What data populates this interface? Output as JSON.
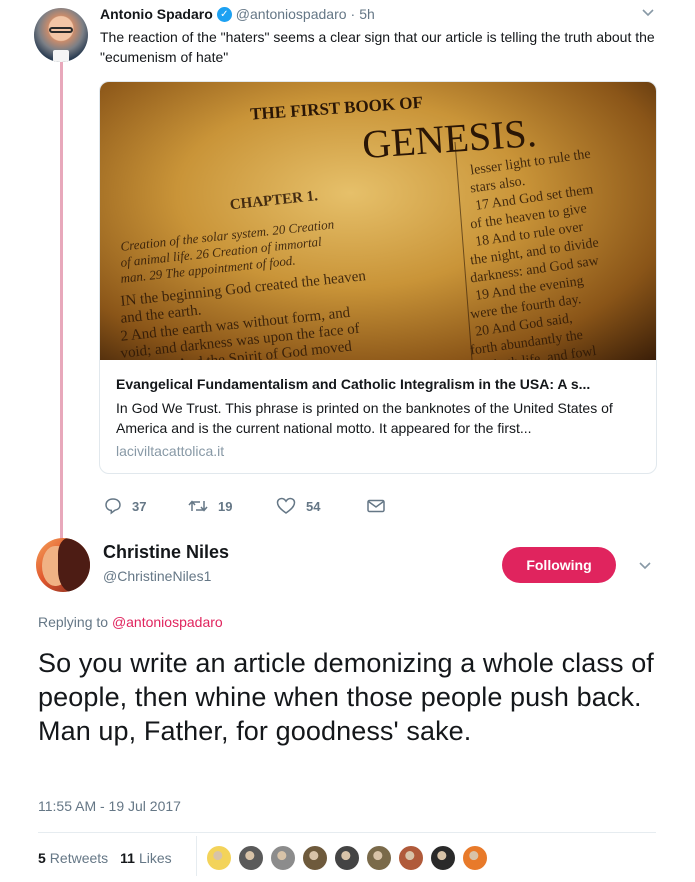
{
  "parent_tweet": {
    "name": "Antonio Spadaro",
    "handle": "@antoniospadaro",
    "time": "5h",
    "text": "The reaction of the \"haters\" seems a clear sign that our article is telling the truth about the \"ecumenism of hate\"",
    "card": {
      "image_title_line": "THE FIRST BOOK OF",
      "image_heading": "GENESIS.",
      "title": "Evangelical Fundamentalism and Catholic Integralism in the USA: A s...",
      "description": "In God We Trust. This phrase is printed on the banknotes of the United States of America and is the current national motto. It appeared for the first...",
      "domain": "laciviltacattolica.it"
    },
    "actions": {
      "replies": "37",
      "retweets": "19",
      "likes": "54"
    }
  },
  "main_tweet": {
    "name": "Christine Niles",
    "handle": "@ChristineNiles1",
    "follow_label": "Following",
    "replying_prefix": "Replying to",
    "replying_to": "@antoniospadaro",
    "text": "So you write an article demonizing a whole class of people, then whine when those people push back. Man up, Father, for goodness' sake.",
    "timestamp": "11:55 AM - 19 Jul 2017",
    "retweets_count": "5",
    "retweets_label": "Retweets",
    "likes_count": "11",
    "likes_label": "Likes"
  },
  "colors": {
    "accent": "#e0245e",
    "verified": "#1da1f2",
    "muted": "#657786",
    "thread_line": "#e8a8bb"
  },
  "likers": [
    "#f3d35a",
    "#5a5a5a",
    "#8c8c8c",
    "#6e5a3c",
    "#444444",
    "#7a6a4a",
    "#b05a3a",
    "#2a2a2a",
    "#e87a2a"
  ]
}
